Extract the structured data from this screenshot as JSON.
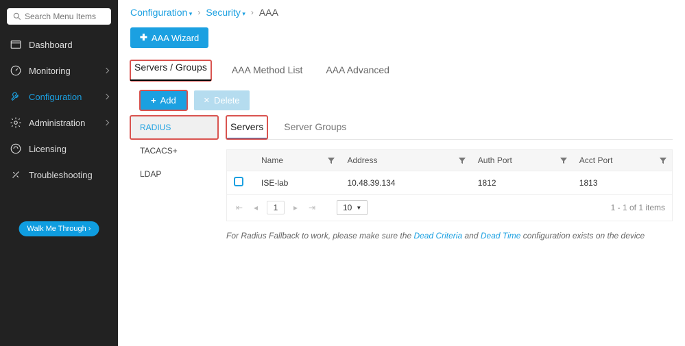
{
  "search": {
    "placeholder": "Search Menu Items"
  },
  "sidebar": {
    "items": [
      {
        "label": "Dashboard"
      },
      {
        "label": "Monitoring"
      },
      {
        "label": "Configuration"
      },
      {
        "label": "Administration"
      },
      {
        "label": "Licensing"
      },
      {
        "label": "Troubleshooting"
      }
    ],
    "walk_label": "Walk Me Through ›"
  },
  "breadcrumb": {
    "a": "Configuration",
    "b": "Security",
    "c": "AAA"
  },
  "wizard_label": "AAA Wizard",
  "tabs": [
    "Servers / Groups",
    "AAA Method List",
    "AAA Advanced"
  ],
  "toolbar": {
    "add": "Add",
    "delete": "Delete"
  },
  "protocols": [
    "RADIUS",
    "TACACS+",
    "LDAP"
  ],
  "subtabs": [
    "Servers",
    "Server Groups"
  ],
  "table": {
    "headers": [
      "Name",
      "Address",
      "Auth Port",
      "Acct Port"
    ],
    "rows": [
      {
        "name": "ISE-lab",
        "address": "10.48.39.134",
        "auth_port": "1812",
        "acct_port": "1813"
      }
    ]
  },
  "pager": {
    "page": "1",
    "size": "10",
    "summary": "1 - 1 of 1 items"
  },
  "note": {
    "t1": "For Radius Fallback to work, please make sure the ",
    "link1": "Dead Criteria",
    "t2": " and ",
    "link2": "Dead Time",
    "t3": " configuration exists on the device"
  }
}
